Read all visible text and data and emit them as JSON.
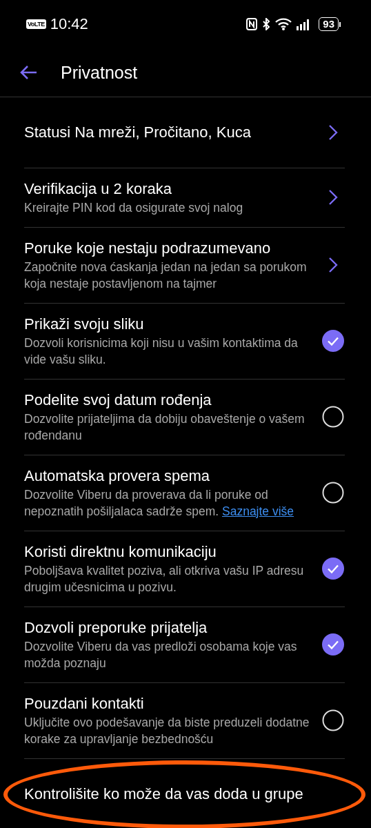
{
  "status_bar": {
    "network_badge": "VoLTE",
    "time": "10:42",
    "battery": "93"
  },
  "header": {
    "title": "Privatnost"
  },
  "items": [
    {
      "kind": "nav",
      "title": "Statusi Na mreži, Pročitano, Kuca"
    },
    {
      "kind": "nav",
      "title": "Verifikacija u 2 koraka",
      "subtitle": "Kreirajte PIN kod da osigurate svoj nalog"
    },
    {
      "kind": "nav",
      "title": "Poruke koje nestaju podrazumevano",
      "subtitle": "Započnite nova ćaskanja jedan na jedan sa porukom koja nestaje postavljenom na tajmer"
    },
    {
      "kind": "toggle",
      "title": "Prikaži svoju sliku",
      "subtitle": "Dozvoli korisnicima koji nisu u vašim kontaktima da vide vašu sliku.",
      "checked": true
    },
    {
      "kind": "toggle",
      "title": "Podelite svoj datum rođenja",
      "subtitle": "Dozvolite prijateljima da dobiju obaveštenje o vašem rođendanu",
      "checked": false
    },
    {
      "kind": "toggle",
      "title": "Automatska provera spema",
      "subtitle": "Dozvolite Viberu da proverava da li poruke od nepoznatih pošiljalaca sadrže spem.",
      "link": "Saznajte više",
      "checked": false
    },
    {
      "kind": "toggle",
      "title": "Koristi direktnu komunikaciju",
      "subtitle": "Poboljšava kvalitet poziva, ali otkriva vašu IP adresu drugim učesnicima u pozivu.",
      "checked": true
    },
    {
      "kind": "toggle",
      "title": "Dozvoli preporuke prijatelja",
      "subtitle": "Dozvolite Viberu da vas predloži osobama koje vas možda poznaju",
      "checked": true
    },
    {
      "kind": "toggle",
      "title": "Pouzdani kontakti",
      "subtitle": "Uključite ovo podešavanje da biste preduzeli dodatne korake za upravljanje bezbednošću",
      "checked": false
    },
    {
      "kind": "plain",
      "title": "Kontrolišite ko može da vas doda u grupe",
      "circled": true
    }
  ]
}
